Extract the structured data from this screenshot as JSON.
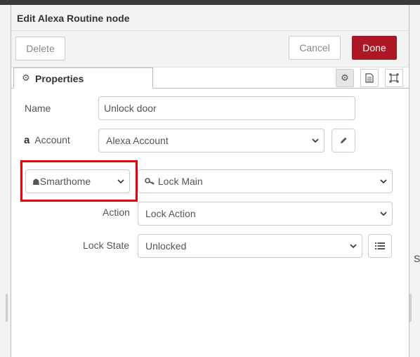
{
  "tray": {
    "title": "Edit Alexa Routine node",
    "delete_label": "Delete",
    "cancel_label": "Cancel",
    "done_label": "Done",
    "done_color": "#ad1625"
  },
  "tabs": {
    "properties_label": "Properties",
    "properties_icon": "gear-icon",
    "icon_buttons": [
      "gear-icon",
      "document-icon",
      "frame-icon"
    ]
  },
  "form": {
    "name_label": "Name",
    "name_value": "Unlock door",
    "account_label": "Account",
    "account_icon": "amazon-icon",
    "account_value": "Alexa Account",
    "account_edit_icon": "pencil-icon",
    "category_value": "Smarthome",
    "category_icon": "home-icon",
    "device_value": "Lock Main",
    "device_icon": "key-icon",
    "action_label": "Action",
    "action_value": "Lock Action",
    "lock_state_label": "Lock State",
    "lock_state_value": "Unlocked",
    "lock_state_list_icon": "list-icon"
  },
  "annotation": {
    "highlight_color": "#e8000b"
  },
  "background": {
    "edge_letter": "S"
  }
}
